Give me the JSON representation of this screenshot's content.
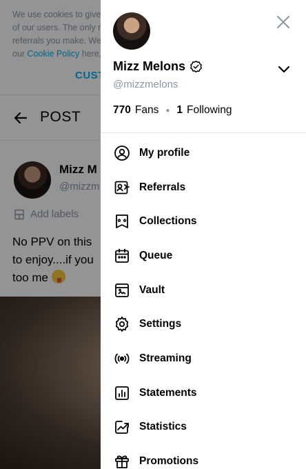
{
  "background": {
    "cookie": {
      "line1": "We use cookies to give",
      "line2": "of our users. The only r",
      "line3": "referrals you make. We",
      "line4_prefix": "our ",
      "policy_link": "Cookie Policy",
      "line4_suffix": " here,",
      "customize": "CUST"
    },
    "header": {
      "title": "POST"
    },
    "post": {
      "author_name": "Mizz M",
      "author_handle": "@mizzm",
      "add_labels": "Add labels",
      "text_line1": "No PPV on this",
      "text_line2": "to enjoy....if you",
      "text_line3": "too me"
    }
  },
  "drawer": {
    "name": "Mizz Melons",
    "handle": "@mizzmelons",
    "fans_count": "770",
    "fans_label": "Fans",
    "following_count": "1",
    "following_label": "Following",
    "menu": [
      {
        "label": "My profile",
        "icon": "user-circle-icon"
      },
      {
        "label": "Referrals",
        "icon": "referrals-icon"
      },
      {
        "label": "Collections",
        "icon": "collections-icon"
      },
      {
        "label": "Queue",
        "icon": "calendar-queue-icon"
      },
      {
        "label": "Vault",
        "icon": "vault-icon"
      },
      {
        "label": "Settings",
        "icon": "gear-icon"
      },
      {
        "label": "Streaming",
        "icon": "broadcast-icon"
      },
      {
        "label": "Statements",
        "icon": "bar-chart-icon"
      },
      {
        "label": "Statistics",
        "icon": "trend-chart-icon"
      },
      {
        "label": "Promotions",
        "icon": "gift-icon"
      }
    ]
  },
  "colors": {
    "accent": "#00aff0",
    "muted": "#8a96a3",
    "divider": "#e3e5e8"
  }
}
